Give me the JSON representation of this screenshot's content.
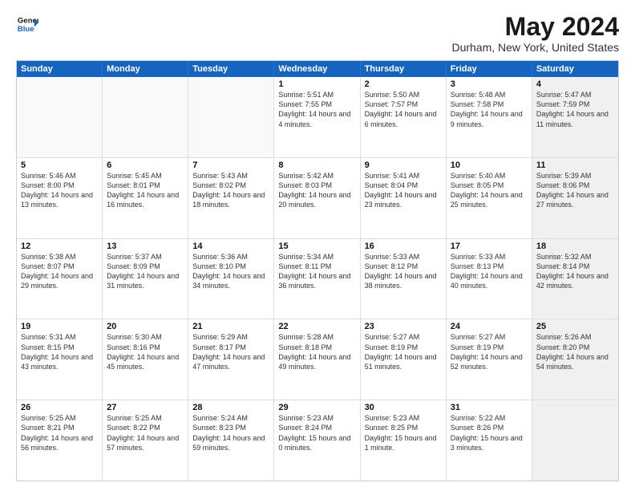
{
  "logo": {
    "line1": "General",
    "line2": "Blue"
  },
  "title": "May 2024",
  "subtitle": "Durham, New York, United States",
  "days": [
    "Sunday",
    "Monday",
    "Tuesday",
    "Wednesday",
    "Thursday",
    "Friday",
    "Saturday"
  ],
  "rows": [
    [
      {
        "num": "",
        "sunrise": "",
        "sunset": "",
        "daylight": "",
        "empty": true
      },
      {
        "num": "",
        "sunrise": "",
        "sunset": "",
        "daylight": "",
        "empty": true
      },
      {
        "num": "",
        "sunrise": "",
        "sunset": "",
        "daylight": "",
        "empty": true
      },
      {
        "num": "1",
        "sunrise": "Sunrise: 5:51 AM",
        "sunset": "Sunset: 7:55 PM",
        "daylight": "Daylight: 14 hours and 4 minutes."
      },
      {
        "num": "2",
        "sunrise": "Sunrise: 5:50 AM",
        "sunset": "Sunset: 7:57 PM",
        "daylight": "Daylight: 14 hours and 6 minutes."
      },
      {
        "num": "3",
        "sunrise": "Sunrise: 5:48 AM",
        "sunset": "Sunset: 7:58 PM",
        "daylight": "Daylight: 14 hours and 9 minutes."
      },
      {
        "num": "4",
        "sunrise": "Sunrise: 5:47 AM",
        "sunset": "Sunset: 7:59 PM",
        "daylight": "Daylight: 14 hours and 11 minutes.",
        "shaded": true
      }
    ],
    [
      {
        "num": "5",
        "sunrise": "Sunrise: 5:46 AM",
        "sunset": "Sunset: 8:00 PM",
        "daylight": "Daylight: 14 hours and 13 minutes."
      },
      {
        "num": "6",
        "sunrise": "Sunrise: 5:45 AM",
        "sunset": "Sunset: 8:01 PM",
        "daylight": "Daylight: 14 hours and 16 minutes."
      },
      {
        "num": "7",
        "sunrise": "Sunrise: 5:43 AM",
        "sunset": "Sunset: 8:02 PM",
        "daylight": "Daylight: 14 hours and 18 minutes."
      },
      {
        "num": "8",
        "sunrise": "Sunrise: 5:42 AM",
        "sunset": "Sunset: 8:03 PM",
        "daylight": "Daylight: 14 hours and 20 minutes."
      },
      {
        "num": "9",
        "sunrise": "Sunrise: 5:41 AM",
        "sunset": "Sunset: 8:04 PM",
        "daylight": "Daylight: 14 hours and 23 minutes."
      },
      {
        "num": "10",
        "sunrise": "Sunrise: 5:40 AM",
        "sunset": "Sunset: 8:05 PM",
        "daylight": "Daylight: 14 hours and 25 minutes."
      },
      {
        "num": "11",
        "sunrise": "Sunrise: 5:39 AM",
        "sunset": "Sunset: 8:06 PM",
        "daylight": "Daylight: 14 hours and 27 minutes.",
        "shaded": true
      }
    ],
    [
      {
        "num": "12",
        "sunrise": "Sunrise: 5:38 AM",
        "sunset": "Sunset: 8:07 PM",
        "daylight": "Daylight: 14 hours and 29 minutes."
      },
      {
        "num": "13",
        "sunrise": "Sunrise: 5:37 AM",
        "sunset": "Sunset: 8:09 PM",
        "daylight": "Daylight: 14 hours and 31 minutes."
      },
      {
        "num": "14",
        "sunrise": "Sunrise: 5:36 AM",
        "sunset": "Sunset: 8:10 PM",
        "daylight": "Daylight: 14 hours and 34 minutes."
      },
      {
        "num": "15",
        "sunrise": "Sunrise: 5:34 AM",
        "sunset": "Sunset: 8:11 PM",
        "daylight": "Daylight: 14 hours and 36 minutes."
      },
      {
        "num": "16",
        "sunrise": "Sunrise: 5:33 AM",
        "sunset": "Sunset: 8:12 PM",
        "daylight": "Daylight: 14 hours and 38 minutes."
      },
      {
        "num": "17",
        "sunrise": "Sunrise: 5:33 AM",
        "sunset": "Sunset: 8:13 PM",
        "daylight": "Daylight: 14 hours and 40 minutes."
      },
      {
        "num": "18",
        "sunrise": "Sunrise: 5:32 AM",
        "sunset": "Sunset: 8:14 PM",
        "daylight": "Daylight: 14 hours and 42 minutes.",
        "shaded": true
      }
    ],
    [
      {
        "num": "19",
        "sunrise": "Sunrise: 5:31 AM",
        "sunset": "Sunset: 8:15 PM",
        "daylight": "Daylight: 14 hours and 43 minutes."
      },
      {
        "num": "20",
        "sunrise": "Sunrise: 5:30 AM",
        "sunset": "Sunset: 8:16 PM",
        "daylight": "Daylight: 14 hours and 45 minutes."
      },
      {
        "num": "21",
        "sunrise": "Sunrise: 5:29 AM",
        "sunset": "Sunset: 8:17 PM",
        "daylight": "Daylight: 14 hours and 47 minutes."
      },
      {
        "num": "22",
        "sunrise": "Sunrise: 5:28 AM",
        "sunset": "Sunset: 8:18 PM",
        "daylight": "Daylight: 14 hours and 49 minutes."
      },
      {
        "num": "23",
        "sunrise": "Sunrise: 5:27 AM",
        "sunset": "Sunset: 8:19 PM",
        "daylight": "Daylight: 14 hours and 51 minutes."
      },
      {
        "num": "24",
        "sunrise": "Sunrise: 5:27 AM",
        "sunset": "Sunset: 8:19 PM",
        "daylight": "Daylight: 14 hours and 52 minutes."
      },
      {
        "num": "25",
        "sunrise": "Sunrise: 5:26 AM",
        "sunset": "Sunset: 8:20 PM",
        "daylight": "Daylight: 14 hours and 54 minutes.",
        "shaded": true
      }
    ],
    [
      {
        "num": "26",
        "sunrise": "Sunrise: 5:25 AM",
        "sunset": "Sunset: 8:21 PM",
        "daylight": "Daylight: 14 hours and 56 minutes."
      },
      {
        "num": "27",
        "sunrise": "Sunrise: 5:25 AM",
        "sunset": "Sunset: 8:22 PM",
        "daylight": "Daylight: 14 hours and 57 minutes."
      },
      {
        "num": "28",
        "sunrise": "Sunrise: 5:24 AM",
        "sunset": "Sunset: 8:23 PM",
        "daylight": "Daylight: 14 hours and 59 minutes."
      },
      {
        "num": "29",
        "sunrise": "Sunrise: 5:23 AM",
        "sunset": "Sunset: 8:24 PM",
        "daylight": "Daylight: 15 hours and 0 minutes."
      },
      {
        "num": "30",
        "sunrise": "Sunrise: 5:23 AM",
        "sunset": "Sunset: 8:25 PM",
        "daylight": "Daylight: 15 hours and 1 minute."
      },
      {
        "num": "31",
        "sunrise": "Sunrise: 5:22 AM",
        "sunset": "Sunset: 8:26 PM",
        "daylight": "Daylight: 15 hours and 3 minutes."
      },
      {
        "num": "",
        "sunrise": "",
        "sunset": "",
        "daylight": "",
        "empty": true,
        "shaded": true
      }
    ]
  ]
}
